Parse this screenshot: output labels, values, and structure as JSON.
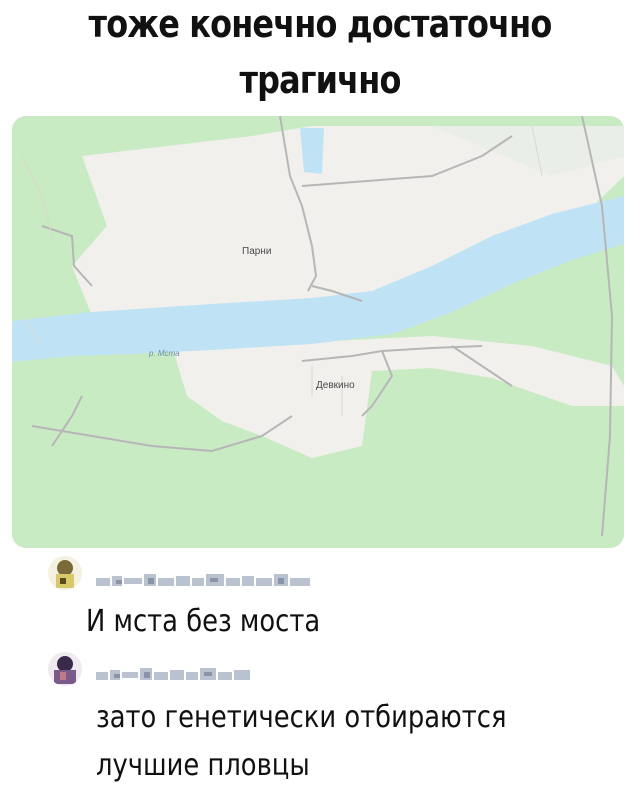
{
  "headline": {
    "line1": "тоже конечно достаточно",
    "line2": "трагично"
  },
  "map": {
    "village_north": "Парни",
    "village_south": "Девкино",
    "river_label": "р. Мста",
    "colors": {
      "forest": "#c9ebc4",
      "settlement": "#f1f0ec",
      "river": "#bfe3f5",
      "road": "#b6b6b6"
    }
  },
  "comments": [
    {
      "text": "И мста без моста"
    },
    {
      "text_line1": "зато генетически отбираются",
      "text_line2": "лучшие пловцы"
    }
  ]
}
